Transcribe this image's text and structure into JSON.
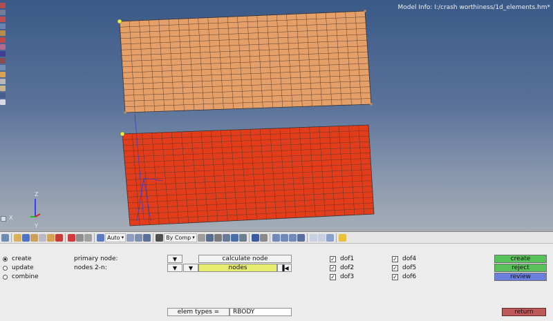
{
  "model_info": "Model Info: I:/crash worthiness/1d_elements.hm*",
  "icons": {
    "left_strip": [
      "view-icon",
      "rotate-icon",
      "pan-icon",
      "zoom-icon",
      "fit-icon",
      "mask-icon",
      "shade-icon",
      "wire-icon",
      "mesh-icon",
      "node-icon",
      "element-icon",
      "component-icon",
      "display-icon",
      "iso-icon",
      "render-icon"
    ],
    "left_strip_colors": [
      "#b14d4d",
      "#6f7d99",
      "#c05050",
      "#6c84b4",
      "#b98c4a",
      "#c04848",
      "#b06b8f",
      "#3f3f8f",
      "#8a4c4c",
      "#6f8cb4",
      "#d9a150",
      "#b8b8b8",
      "#c9b48f",
      "#4a5d8f",
      "#d9d9e8"
    ]
  },
  "viewport": {
    "axis_labels": {
      "z": "Z",
      "y": "Y",
      "x": "X"
    },
    "colors": {
      "top_mesh": "#e5a06a",
      "bottom_mesh": "#e23c1b",
      "mesh_lines": "#5a3a28",
      "rbody_link": "#3a3ec9",
      "node": "#e8ef3b"
    }
  },
  "toolbar": {
    "auto_label": "Auto",
    "bycomp_label": "By Comp"
  },
  "panel": {
    "radios": [
      {
        "label": "create",
        "selected": true
      },
      {
        "label": "update",
        "selected": false
      },
      {
        "label": "combine",
        "selected": false
      }
    ],
    "primary_node_label": "primary node:",
    "nodes_label": "nodes 2-n:",
    "calculate_node_label": "calculate node",
    "nodes_field": "nodes",
    "dofs": [
      {
        "label": "dof1",
        "checked": true
      },
      {
        "label": "dof2",
        "checked": true
      },
      {
        "label": "dof3",
        "checked": true
      },
      {
        "label": "dof4",
        "checked": true
      },
      {
        "label": "dof5",
        "checked": true
      },
      {
        "label": "dof6",
        "checked": true
      }
    ],
    "check_mark": "✓",
    "actions": {
      "create": "create",
      "reject": "reject",
      "review": "review",
      "return": "return"
    },
    "action_colors": {
      "create": "#59c159",
      "reject": "#59c159",
      "review": "#6b7fdc",
      "return": "#c05a5a"
    },
    "elem_types_label": "elem types =",
    "elem_types_value": "RBODY"
  }
}
